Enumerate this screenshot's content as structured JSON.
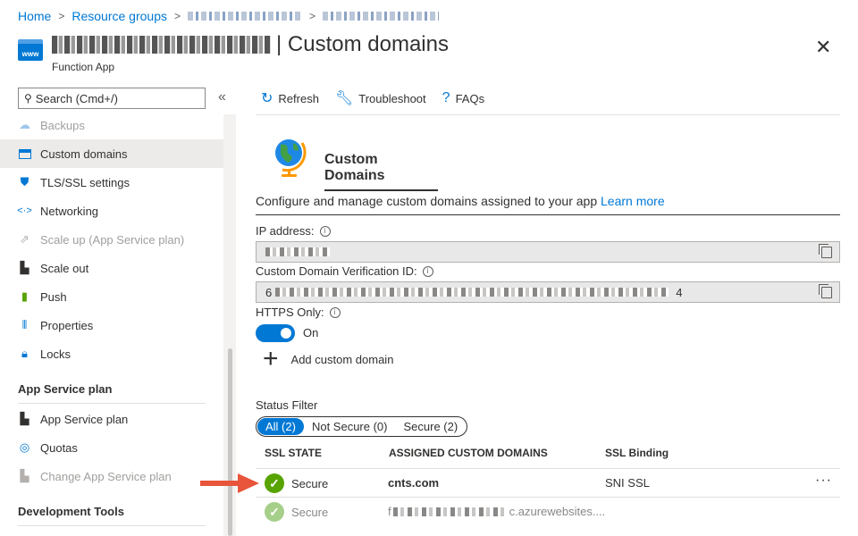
{
  "breadcrumb": {
    "home": "Home",
    "resource_groups": "Resource groups",
    "sep": ">"
  },
  "header": {
    "app_icon_label": "www",
    "title_suffix": "| Custom domains",
    "subtitle": "Function App",
    "close_glyph": "✕"
  },
  "sidebar": {
    "search_placeholder": "Search (Cmd+/)",
    "collapse_glyph": "«",
    "items": [
      {
        "label": "Backups",
        "icon": "cloud-icon",
        "disabled": true
      },
      {
        "label": "Custom domains",
        "icon": "window-icon",
        "selected": true
      },
      {
        "label": "TLS/SSL settings",
        "icon": "shield-icon"
      },
      {
        "label": "Networking",
        "icon": "network-icon"
      },
      {
        "label": "Scale up (App Service plan)",
        "icon": "scale-up-icon",
        "disabled": true
      },
      {
        "label": "Scale out",
        "icon": "scale-out-icon"
      },
      {
        "label": "Push",
        "icon": "push-icon"
      },
      {
        "label": "Properties",
        "icon": "properties-icon"
      },
      {
        "label": "Locks",
        "icon": "lock-icon"
      }
    ],
    "section_app_service": "App Service plan",
    "items2": [
      {
        "label": "App Service plan",
        "icon": "app-service-plan-icon"
      },
      {
        "label": "Quotas",
        "icon": "quotas-icon"
      },
      {
        "label": "Change App Service plan",
        "icon": "change-plan-icon",
        "disabled": true
      }
    ],
    "section_dev": "Development Tools"
  },
  "toolbar": {
    "refresh": "Refresh",
    "troubleshoot": "Troubleshoot",
    "faqs": "FAQs"
  },
  "main": {
    "hero_title": "Custom Domains",
    "description": "Configure and manage custom domains assigned to your app",
    "learn_more": "Learn more",
    "ip_label": "IP address:",
    "verification_label": "Custom Domain Verification ID:",
    "verification_prefix": "6",
    "verification_suffix": "4",
    "https_label": "HTTPS Only:",
    "https_state": "On",
    "add_domain": "Add custom domain",
    "status_filter_label": "Status Filter",
    "filters": [
      "All (2)",
      "Not Secure (0)",
      "Secure (2)"
    ],
    "columns": [
      "SSL STATE",
      "ASSIGNED CUSTOM DOMAINS",
      "SSL Binding"
    ],
    "rows": [
      {
        "state": "Secure",
        "domain": "cnts.com",
        "binding": "SNI SSL",
        "more": "···"
      },
      {
        "state": "Secure",
        "domain_prefix": "f",
        "domain_suffix": "c.azurewebsites....",
        "binding": ""
      }
    ]
  },
  "colors": {
    "accent": "#0078d4",
    "secure": "#57a300",
    "annotation_arrow": "#e8553b"
  }
}
